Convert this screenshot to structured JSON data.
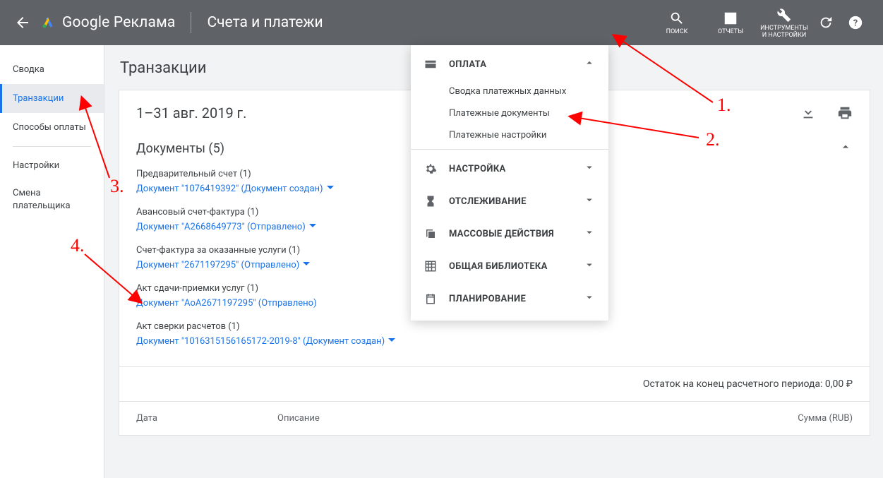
{
  "header": {
    "product": "Google Реклама",
    "page_title": "Счета и платежи",
    "search_label": "ПОИСК",
    "reports_label": "ОТЧЕТЫ",
    "tools_label": "ИНСТРУМЕНТЫ\nИ НАСТРОЙКИ"
  },
  "sidebar": {
    "items": [
      "Сводка",
      "Транзакции",
      "Способы оплаты",
      "Настройки",
      "Смена\nплательщика"
    ]
  },
  "main": {
    "section_title": "Транзакции",
    "date_range": "1–31 авг. 2019 г.",
    "docs_title": "Документы (5)",
    "doc_groups": [
      {
        "label": "Предварительный счет (1)",
        "link": "Документ \"1076419392\" (Документ создан)"
      },
      {
        "label": "Авансовый счет-фактура (1)",
        "link": "Документ \"A2668649773\" (Отправлено)"
      },
      {
        "label": "Счет-фактура за оказанные услуги (1)",
        "link": "Документ \"2671197295\" (Отправлено)"
      },
      {
        "label": "Акт сдачи-приемки услуг (1)",
        "link": "Документ \"AoA2671197295\" (Отправлено)"
      },
      {
        "label": "Акт сверки расчетов (1)",
        "link": "Документ \"1016315156165172-2019-8\" (Документ создан)"
      }
    ],
    "balance_text": "Остаток на конец расчетного периода: 0,00 ₽",
    "cols": {
      "date": "Дата",
      "desc": "Описание",
      "sum": "Сумма (RUB)"
    }
  },
  "tools_menu": {
    "sections": [
      {
        "label": "ОПЛАТА",
        "expanded": true,
        "icon": "card",
        "subs": [
          "Сводка платежных данных",
          "Платежные документы",
          "Платежные настройки"
        ]
      },
      {
        "label": "НАСТРОЙКА",
        "expanded": false,
        "icon": "gear"
      },
      {
        "label": "ОТСЛЕЖИВАНИЕ",
        "expanded": false,
        "icon": "hourglass"
      },
      {
        "label": "МАССОВЫЕ ДЕЙСТВИЯ",
        "expanded": false,
        "icon": "copy"
      },
      {
        "label": "ОБЩАЯ БИБЛИОТЕКА",
        "expanded": false,
        "icon": "grid"
      },
      {
        "label": "ПЛАНИРОВАНИЕ",
        "expanded": false,
        "icon": "calendar"
      }
    ]
  },
  "annotations": {
    "a1": "1.",
    "a2": "2.",
    "a3": "3.",
    "a4": "4."
  }
}
